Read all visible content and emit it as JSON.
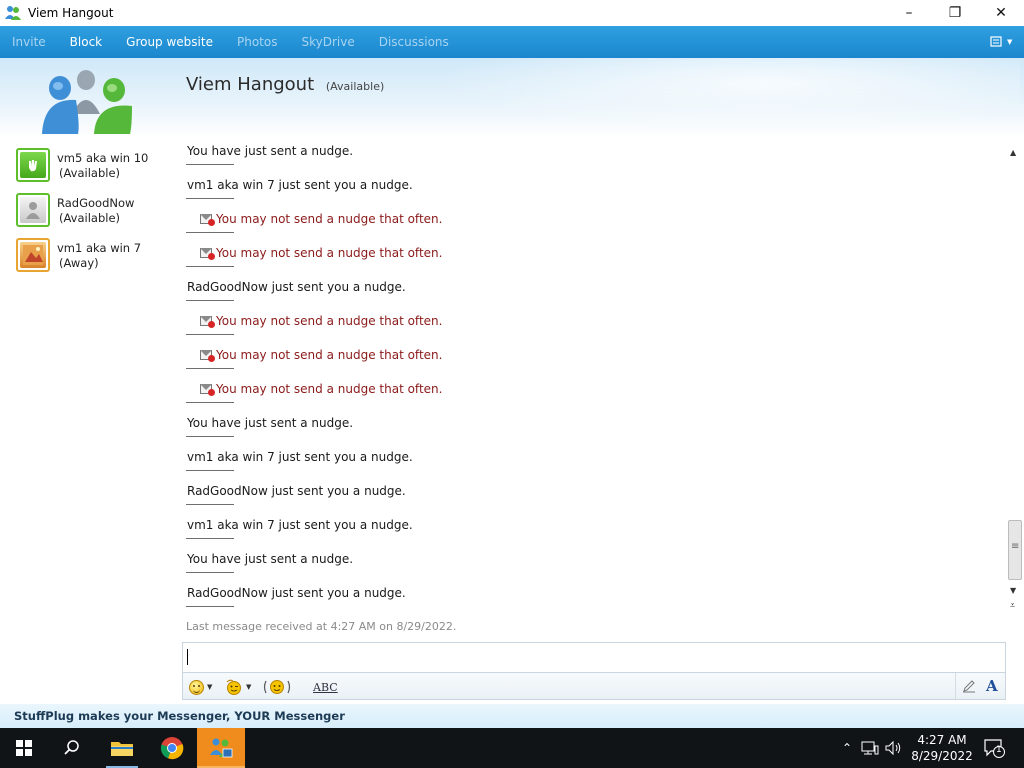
{
  "window": {
    "title": "Viem Hangout",
    "controls": {
      "minimize": "–",
      "restore": "❐",
      "close": "✕"
    }
  },
  "menu": [
    {
      "label": "Invite",
      "enabled": false
    },
    {
      "label": "Block",
      "enabled": true
    },
    {
      "label": "Group website",
      "enabled": true
    },
    {
      "label": "Photos",
      "enabled": false
    },
    {
      "label": "SkyDrive",
      "enabled": false
    },
    {
      "label": "Discussions",
      "enabled": false
    }
  ],
  "header": {
    "title": "Viem Hangout",
    "status": "(Available)"
  },
  "contacts": [
    {
      "name": "vm5 aka win 10",
      "status": "(Available)",
      "presence": "available",
      "icon": "hand-icon"
    },
    {
      "name": "RadGoodNow",
      "status": "(Available)",
      "presence": "available",
      "icon": "default-user-icon"
    },
    {
      "name": "vm1 aka win 7",
      "status": "(Away)",
      "presence": "away",
      "icon": "photo-icon"
    }
  ],
  "messages": [
    {
      "text": "You have just sent a nudge.",
      "error": false
    },
    {
      "text": "vm1 aka win 7 just sent you a nudge.",
      "error": false
    },
    {
      "text": "You may not send a nudge that often.",
      "error": true
    },
    {
      "text": "You may not send a nudge that often.",
      "error": true
    },
    {
      "text": "RadGoodNow just sent you a nudge.",
      "error": false
    },
    {
      "text": "You may not send a nudge that often.",
      "error": true
    },
    {
      "text": "You may not send a nudge that often.",
      "error": true
    },
    {
      "text": "You may not send a nudge that often.",
      "error": true
    },
    {
      "text": "You have just sent a nudge.",
      "error": false
    },
    {
      "text": "vm1 aka win 7 just sent you a nudge.",
      "error": false
    },
    {
      "text": "RadGoodNow just sent you a nudge.",
      "error": false
    },
    {
      "text": "vm1 aka win 7 just sent you a nudge.",
      "error": false
    },
    {
      "text": "You have just sent a nudge.",
      "error": false
    },
    {
      "text": "RadGoodNow just sent you a nudge.",
      "error": false
    }
  ],
  "last_message": "Last message received at 4:27 AM on 8/29/2022.",
  "input": {
    "value": ""
  },
  "format_toolbar": {
    "emoticon_icon": "smiley-icon",
    "wink_icon": "wink-icon",
    "nudge_icon": "nudge-icon",
    "spell_label": "ABC",
    "font_label": "A"
  },
  "promo": "StuffPlug makes your Messenger, YOUR Messenger",
  "taskbar": {
    "time": "4:27 AM",
    "date": "8/29/2022",
    "notifications": "1"
  },
  "colors": {
    "menubar": "#1b86cd",
    "error_text": "#8b1a1a",
    "available": "#5fbf2a",
    "away": "#e8a531",
    "active_task": "#f08c1e"
  }
}
